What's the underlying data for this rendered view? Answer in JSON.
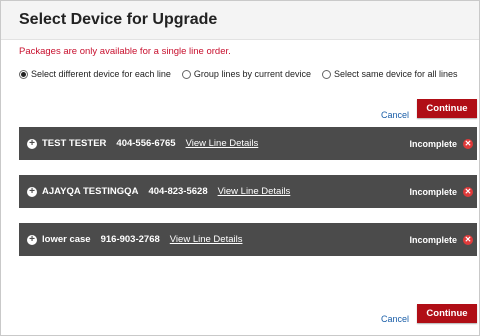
{
  "header": {
    "title": "Select Device for Upgrade"
  },
  "warning": "Packages are only available for a single line order.",
  "radio_options": [
    {
      "label": "Select different device for each line",
      "selected": true
    },
    {
      "label": "Group lines by current device",
      "selected": false
    },
    {
      "label": "Select same device for all lines",
      "selected": false
    }
  ],
  "actions": {
    "cancel_label": "Cancel",
    "continue_label": "Continue"
  },
  "lines": [
    {
      "name": "TEST  TESTER",
      "phone": "404-556-6765",
      "link": "View Line Details",
      "status": "Incomplete"
    },
    {
      "name": "AJAYQA  TESTINGQA",
      "phone": "404-823-5628",
      "link": "View Line Details",
      "status": "Incomplete"
    },
    {
      "name": "lower  case",
      "phone": "916-903-2768",
      "link": "View Line Details",
      "status": "Incomplete"
    }
  ],
  "colors": {
    "accent": "#b00e16",
    "panel": "#4b4b4b",
    "warning": "#c8102e",
    "link": "#1a5ea8"
  }
}
